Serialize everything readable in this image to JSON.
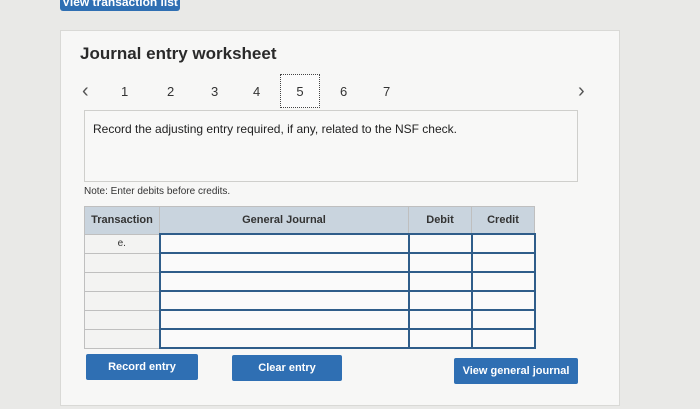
{
  "header": {
    "view_transactions_label": "View transaction list"
  },
  "worksheet": {
    "title": "Journal entry worksheet"
  },
  "pager": {
    "prev_icon": "chevron-left-icon",
    "next_icon": "chevron-right-icon",
    "pages": [
      "1",
      "2",
      "3",
      "4",
      "5",
      "6",
      "7"
    ],
    "active_page": "5"
  },
  "instruction": "Record the adjusting entry required, if any, related to the NSF check.",
  "note": "Note: Enter debits before credits.",
  "table": {
    "headers": {
      "transaction": "Transaction",
      "general_journal": "General Journal",
      "debit": "Debit",
      "credit": "Credit"
    },
    "rows": [
      {
        "transaction": "e.",
        "general_journal": "",
        "debit": "",
        "credit": ""
      },
      {
        "transaction": "",
        "general_journal": "",
        "debit": "",
        "credit": ""
      },
      {
        "transaction": "",
        "general_journal": "",
        "debit": "",
        "credit": ""
      },
      {
        "transaction": "",
        "general_journal": "",
        "debit": "",
        "credit": ""
      },
      {
        "transaction": "",
        "general_journal": "",
        "debit": "",
        "credit": ""
      },
      {
        "transaction": "",
        "general_journal": "",
        "debit": "",
        "credit": ""
      }
    ]
  },
  "buttons": {
    "record": "Record entry",
    "clear": "Clear entry",
    "view_journal": "View general journal"
  },
  "colors": {
    "accent": "#2f6fb3",
    "header_bg": "#c9d4de",
    "input_border": "#2f5d8a"
  }
}
